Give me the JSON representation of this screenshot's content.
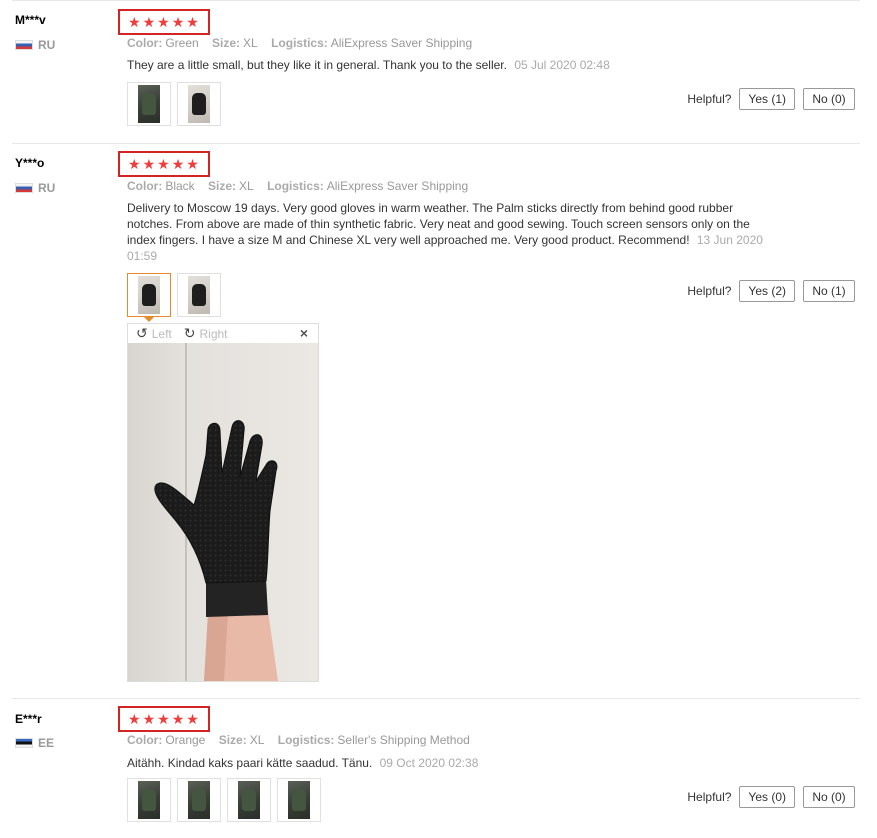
{
  "colors": {
    "star": "#f23b3b",
    "highlight_box": "#d32424",
    "meta": "#999999",
    "active_thumb": "#e88a2a"
  },
  "labels": {
    "color": "Color:",
    "size": "Size:",
    "logistics": "Logistics:",
    "helpful": "Helpful?"
  },
  "reviews": [
    {
      "user": "M***v",
      "country": "RU",
      "rating": 5,
      "color": "Green",
      "size": "XL",
      "logistics": "AliExpress Saver Shipping",
      "text": "They are a little small, but they like it in general. Thank you to the seller.",
      "date": "05 Jul 2020 02:48",
      "yes": "Yes (1)",
      "no": "No (0)"
    },
    {
      "user": "Y***o",
      "country": "RU",
      "rating": 5,
      "color": "Black",
      "size": "XL",
      "logistics": "AliExpress Saver Shipping",
      "text": "Delivery to Moscow 19 days. Very good gloves in warm weather. The Palm sticks directly from behind good rubber notches. From above are made of thin synthetic fabric. Very neat and good sewing. Touch screen sensors only on the index fingers. I have a size M and Chinese XL very well approached me. Very good product. Recommend!",
      "date": "13 Jun 2020 01:59",
      "yes": "Yes (2)",
      "no": "No (1)"
    },
    {
      "user": "E***r",
      "country": "EE",
      "rating": 5,
      "color": "Orange",
      "size": "XL",
      "logistics": "Seller's Shipping Method",
      "text": "Aitähh. Kindad kaks paari kätte saadud. Tänu.",
      "date": "09 Oct 2020 02:38",
      "yes": "Yes (0)",
      "no": "No (0)"
    }
  ],
  "viewer": {
    "rotate_left": "Left",
    "rotate_right": "Right",
    "close_glyph": "×",
    "rotate_left_icon": "rotate-left-icon",
    "rotate_right_icon": "rotate-right-icon"
  }
}
